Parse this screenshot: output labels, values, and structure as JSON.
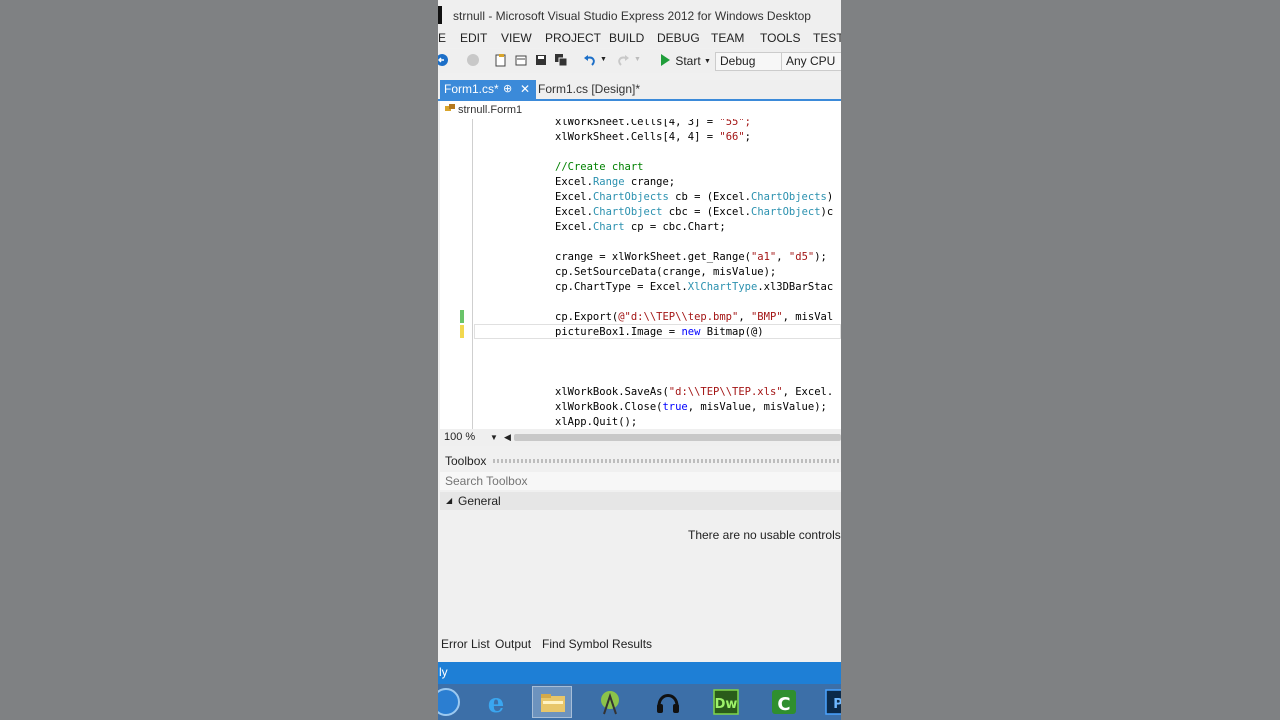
{
  "window": {
    "title": "strnull - Microsoft Visual Studio Express 2012 for Windows Desktop"
  },
  "menu": {
    "items": [
      "E",
      "EDIT",
      "VIEW",
      "PROJECT",
      "BUILD",
      "DEBUG",
      "TEAM",
      "TOOLS",
      "TEST"
    ]
  },
  "toolbar": {
    "start_label": "Start",
    "config_value": "Debug",
    "platform_value": "Any CPU"
  },
  "tabs": {
    "active": "Form1.cs*",
    "inactive": "Form1.cs [Design]*"
  },
  "navbar": {
    "class_path": "strnull.Form1"
  },
  "code": {
    "line1_pre": "xlWorkSheet.Cells[4, 3] = ",
    "line1_str": "\"55\";",
    "line2_pre": "xlWorkSheet.Cells[4, 4] = ",
    "line2_str": "\"66\"",
    "line2_post": ";",
    "comment": "//Create chart",
    "excel1": "Excel.",
    "range_type": "Range",
    "crange_decl": " crange;",
    "excel2": "Excel.",
    "chartobjects_type": "ChartObjects",
    "cb_decl": " cb = (Excel.",
    "chartobjects_type2": "ChartObjects",
    "cb_end": ")",
    "excel3": "Excel.",
    "chartobject_type": "ChartObject",
    "cbc_decl": " cbc = (Excel.",
    "chartobject_type2": "ChartObject",
    "cbc_end": ")c",
    "excel4": "Excel.",
    "chart_type": "Chart",
    "cp_decl": " cp = cbc.Chart;",
    "getrange_pre": "crange = xlWorkSheet.get_Range(",
    "getrange_a1": "\"a1\"",
    "getrange_mid": ", ",
    "getrange_d5": "\"d5\"",
    "getrange_end": ");",
    "setsource": "cp.SetSourceData(crange, misValue);",
    "charttype_pre": "cp.ChartType = Excel.",
    "xlcharttype": "XlChartType",
    "charttype_post": ".xl3DBarStac",
    "export_pre": "cp.Export(",
    "export_path": "@\"d:\\\\TEP\\\\tep.bmp\"",
    "export_mid": ", ",
    "export_bmp": "\"BMP\"",
    "export_post": ", misVal",
    "picture_pre": "pictureBox1.Image = ",
    "picture_new": "new",
    "picture_post": " Bitmap(@)",
    "saveas_pre": "xlWorkBook.SaveAs(",
    "saveas_path": "\"d:\\\\TEP\\\\TEP.xls\"",
    "saveas_post": ", Excel.",
    "close": "xlWorkBook.Close(",
    "close_true": "true",
    "close_post": ", misValue, misValue);",
    "quit": "xlApp.Quit();"
  },
  "zoom": {
    "level": "100 %"
  },
  "toolbox": {
    "title": "Toolbox",
    "search_placeholder": "Search Toolbox",
    "group": "General",
    "empty_message": "There are no usable controls in"
  },
  "bottom_tabs": [
    "Error List",
    "Output",
    "Find Symbol Results"
  ],
  "status": {
    "text": "ly"
  },
  "colors": {
    "accent": "#3b8ad9",
    "statusbar": "#1e7fd6",
    "keyword": "#0000ff",
    "type": "#2b91af",
    "string": "#a31515",
    "comment": "#008000"
  }
}
